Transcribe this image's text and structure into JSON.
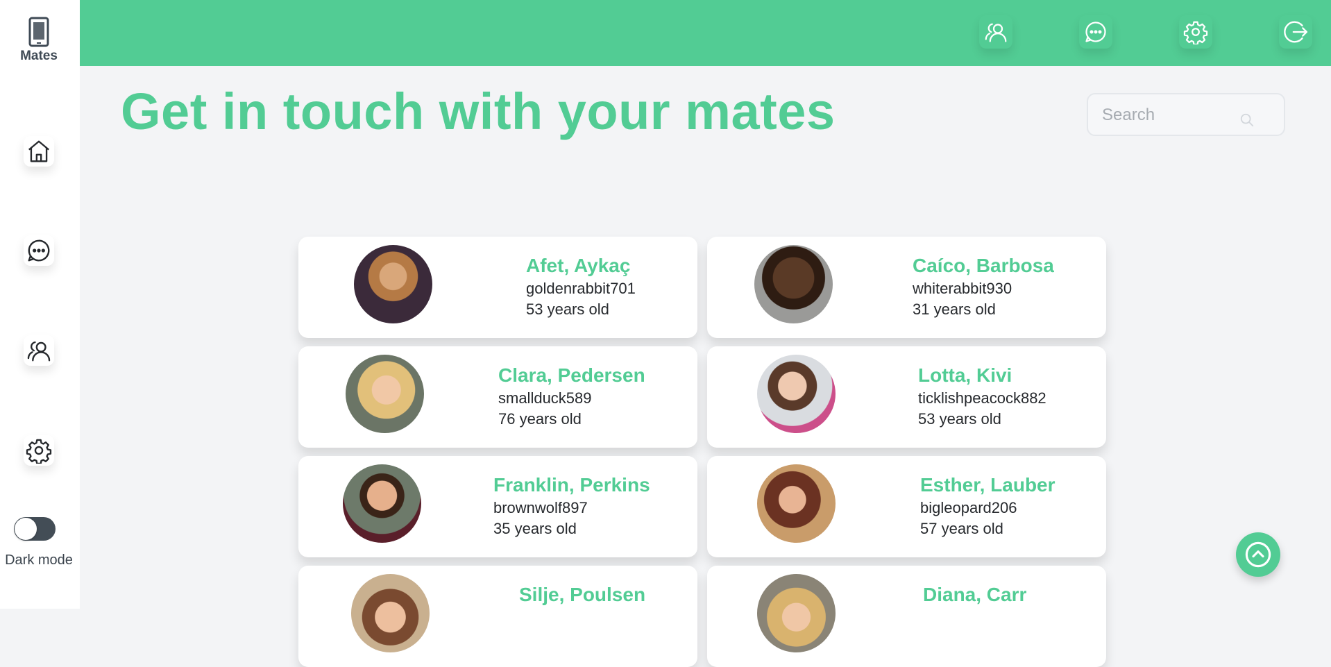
{
  "app": {
    "logo_text": "Mates"
  },
  "sidebar": {
    "items": [
      {
        "icon": "home-icon"
      },
      {
        "icon": "chat-icon"
      },
      {
        "icon": "users-icon"
      },
      {
        "icon": "gear-icon"
      }
    ],
    "dark_mode_label": "Dark mode",
    "dark_mode_on": false
  },
  "topbar": {
    "icons": [
      "users-icon",
      "chat-icon",
      "gear-icon",
      "logout-icon"
    ]
  },
  "main": {
    "title": "Get in touch with your mates",
    "search_placeholder": "Search",
    "search_value": ""
  },
  "colors": {
    "accent": "#52cc94",
    "background": "#f3f4f6",
    "toggle_track": "#434d56",
    "text": "#26292d"
  },
  "mates": [
    {
      "name": "Afet, Aykaç",
      "username": "goldenrabbit701",
      "age": "53 years old"
    },
    {
      "name": "Caíco, Barbosa",
      "username": "whiterabbit930",
      "age": "31 years old"
    },
    {
      "name": "Clara, Pedersen",
      "username": "smallduck589",
      "age": "76 years old"
    },
    {
      "name": "Lotta, Kivi",
      "username": "ticklishpeacock882",
      "age": "53 years old"
    },
    {
      "name": "Franklin, Perkins",
      "username": "brownwolf897",
      "age": "35 years old"
    },
    {
      "name": "Esther, Lauber",
      "username": "bigleopard206",
      "age": "57 years old"
    },
    {
      "name": "Silje, Poulsen",
      "username": "",
      "age": ""
    },
    {
      "name": "Diana, Carr",
      "username": "",
      "age": ""
    }
  ]
}
